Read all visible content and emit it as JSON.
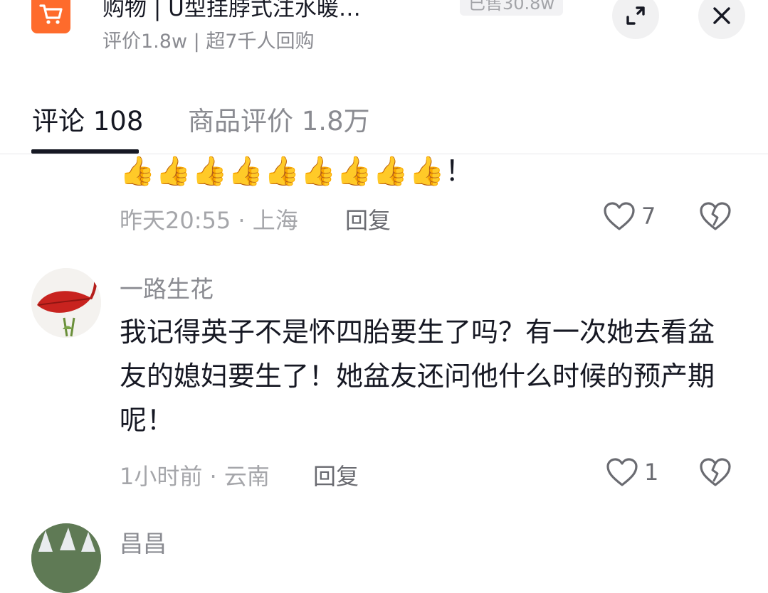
{
  "header": {
    "title": "购物 | U型挂脖式注水暖…",
    "sold": "已售30.8w",
    "subtitle": "评价1.8w | 超7千人回购",
    "icons": [
      "shopping-cart-icon",
      "expand-icon",
      "close-icon"
    ]
  },
  "tabs": [
    {
      "label": "评论 108",
      "active": true
    },
    {
      "label": "商品评价 1.8万",
      "active": false
    }
  ],
  "comments": [
    {
      "text": "👍👍👍👍👍👍👍👍👍！",
      "time_location": "昨天20:55 · 上海",
      "reply_label": "回复",
      "likes": "7"
    },
    {
      "username": "一路生花",
      "text": "我记得英子不是怀四胎要生了吗？有一次她去看盆友的媳妇要生了！她盆友还问他什么时候的预产期呢！",
      "time_location": "1小时前 · 云南",
      "reply_label": "回复",
      "likes": "1"
    },
    {
      "username": "昌昌"
    }
  ],
  "colors": {
    "accent_orange": "#fe6b2c",
    "text_primary": "#161823",
    "text_secondary": "#8a8b91"
  }
}
